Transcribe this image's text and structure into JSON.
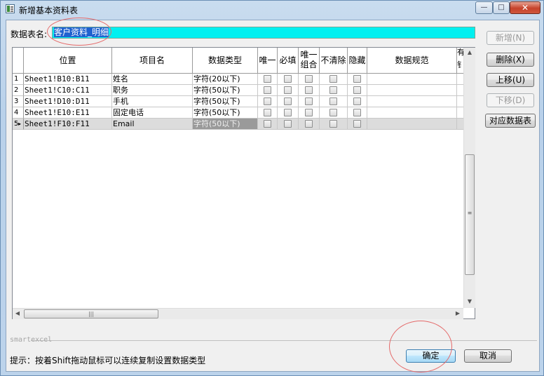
{
  "window": {
    "title": "新增基本资料表",
    "min_glyph": "—",
    "max_glyph": "□",
    "close_glyph": "✕"
  },
  "form": {
    "table_name_label": "数据表名:",
    "table_name_value": "客户资料_明细"
  },
  "grid": {
    "columns": [
      "位置",
      "项目名",
      "数据类型",
      "唯一",
      "必填",
      "唯一组合",
      "不清除",
      "隐藏",
      "数据规范",
      "有",
      "钅"
    ],
    "rows": [
      {
        "num": "1",
        "position": "Sheet1!B10:B11",
        "item": "姓名",
        "type": "字符(20以下)",
        "unique": false,
        "required": false,
        "combo": false,
        "noclear": false,
        "hidden": false,
        "spec": ""
      },
      {
        "num": "2",
        "position": "Sheet1!C10:C11",
        "item": "职务",
        "type": "字符(50以下)",
        "unique": false,
        "required": false,
        "combo": false,
        "noclear": false,
        "hidden": false,
        "spec": ""
      },
      {
        "num": "3",
        "position": "Sheet1!D10:D11",
        "item": "手机",
        "type": "字符(50以下)",
        "unique": false,
        "required": false,
        "combo": false,
        "noclear": false,
        "hidden": false,
        "spec": ""
      },
      {
        "num": "4",
        "position": "Sheet1!E10:E11",
        "item": "固定电话",
        "type": "字符(50以下)",
        "unique": false,
        "required": false,
        "combo": false,
        "noclear": false,
        "hidden": false,
        "spec": ""
      },
      {
        "num": "5",
        "position": "Sheet1!F10:F11",
        "item": "Email",
        "type": "字符(50以下)",
        "unique": false,
        "required": false,
        "combo": false,
        "noclear": false,
        "hidden": false,
        "spec": ""
      }
    ],
    "selected_row_marker": "▸",
    "hscroll_grip": "|||",
    "vscroll_grip": "≡"
  },
  "buttons": {
    "add": "新增(N)",
    "delete": "删除(X)",
    "move_up": "上移(U)",
    "move_down": "下移(D)",
    "map_table": "对应数据表",
    "ok": "确定",
    "cancel": "取消"
  },
  "footer": {
    "brand": "smartexcel",
    "hint": "提示：按着Shift拖动鼠标可以连续复制设置数据类型"
  },
  "colors": {
    "table_name_bg": "#00f0f0",
    "highlight_circle": "#e46a6a",
    "title_bar": "#b9d1ea"
  }
}
